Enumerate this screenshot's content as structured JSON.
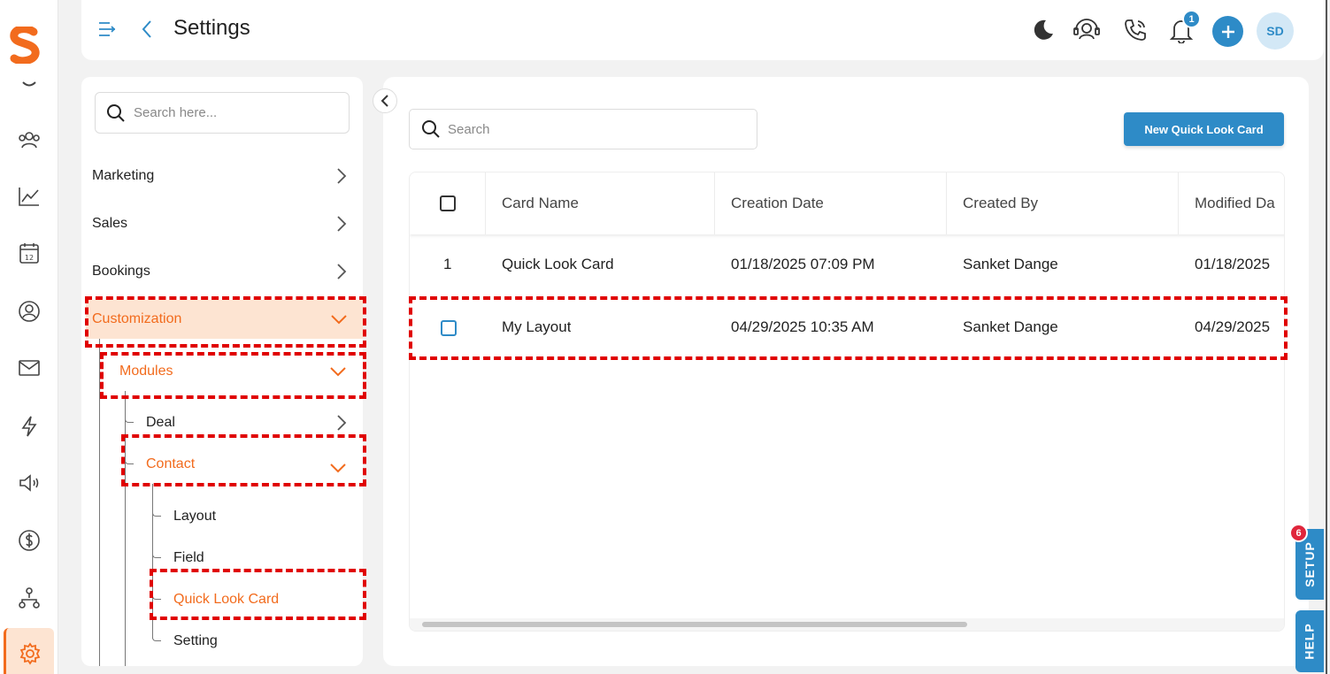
{
  "header": {
    "title": "Settings",
    "notification_count": "1",
    "avatar_initials": "SD"
  },
  "sidebar": {
    "search_placeholder": "Search here...",
    "items": [
      {
        "label": "Marketing"
      },
      {
        "label": "Sales"
      },
      {
        "label": "Bookings"
      },
      {
        "label": "Customization"
      },
      {
        "label": "Modules"
      },
      {
        "label": "Deal"
      },
      {
        "label": "Contact"
      },
      {
        "label": "Layout"
      },
      {
        "label": "Field"
      },
      {
        "label": "Quick Look Card"
      },
      {
        "label": "Setting"
      }
    ]
  },
  "main": {
    "search_placeholder": "Search",
    "new_button_label": "New Quick Look Card",
    "columns": [
      "Card Name",
      "Creation Date",
      "Created By",
      "Modified Da"
    ],
    "rows": [
      {
        "index": "1",
        "card_name": "Quick Look Card",
        "creation_date": "01/18/2025 07:09 PM",
        "created_by": "Sanket Dange",
        "modified_date": "01/18/2025"
      },
      {
        "index": "",
        "card_name": "My Layout",
        "creation_date": "04/29/2025 10:35 AM",
        "created_by": "Sanket Dange",
        "modified_date": "04/29/2025"
      }
    ]
  },
  "right_tabs": {
    "setup_label": "SETUP",
    "setup_badge": "6",
    "help_label": "HELP"
  },
  "colors": {
    "accent_blue": "#2e8bc7",
    "accent_orange": "#f26b1d",
    "highlight_bg": "#fde4d2",
    "annotation_red": "#e00000"
  }
}
